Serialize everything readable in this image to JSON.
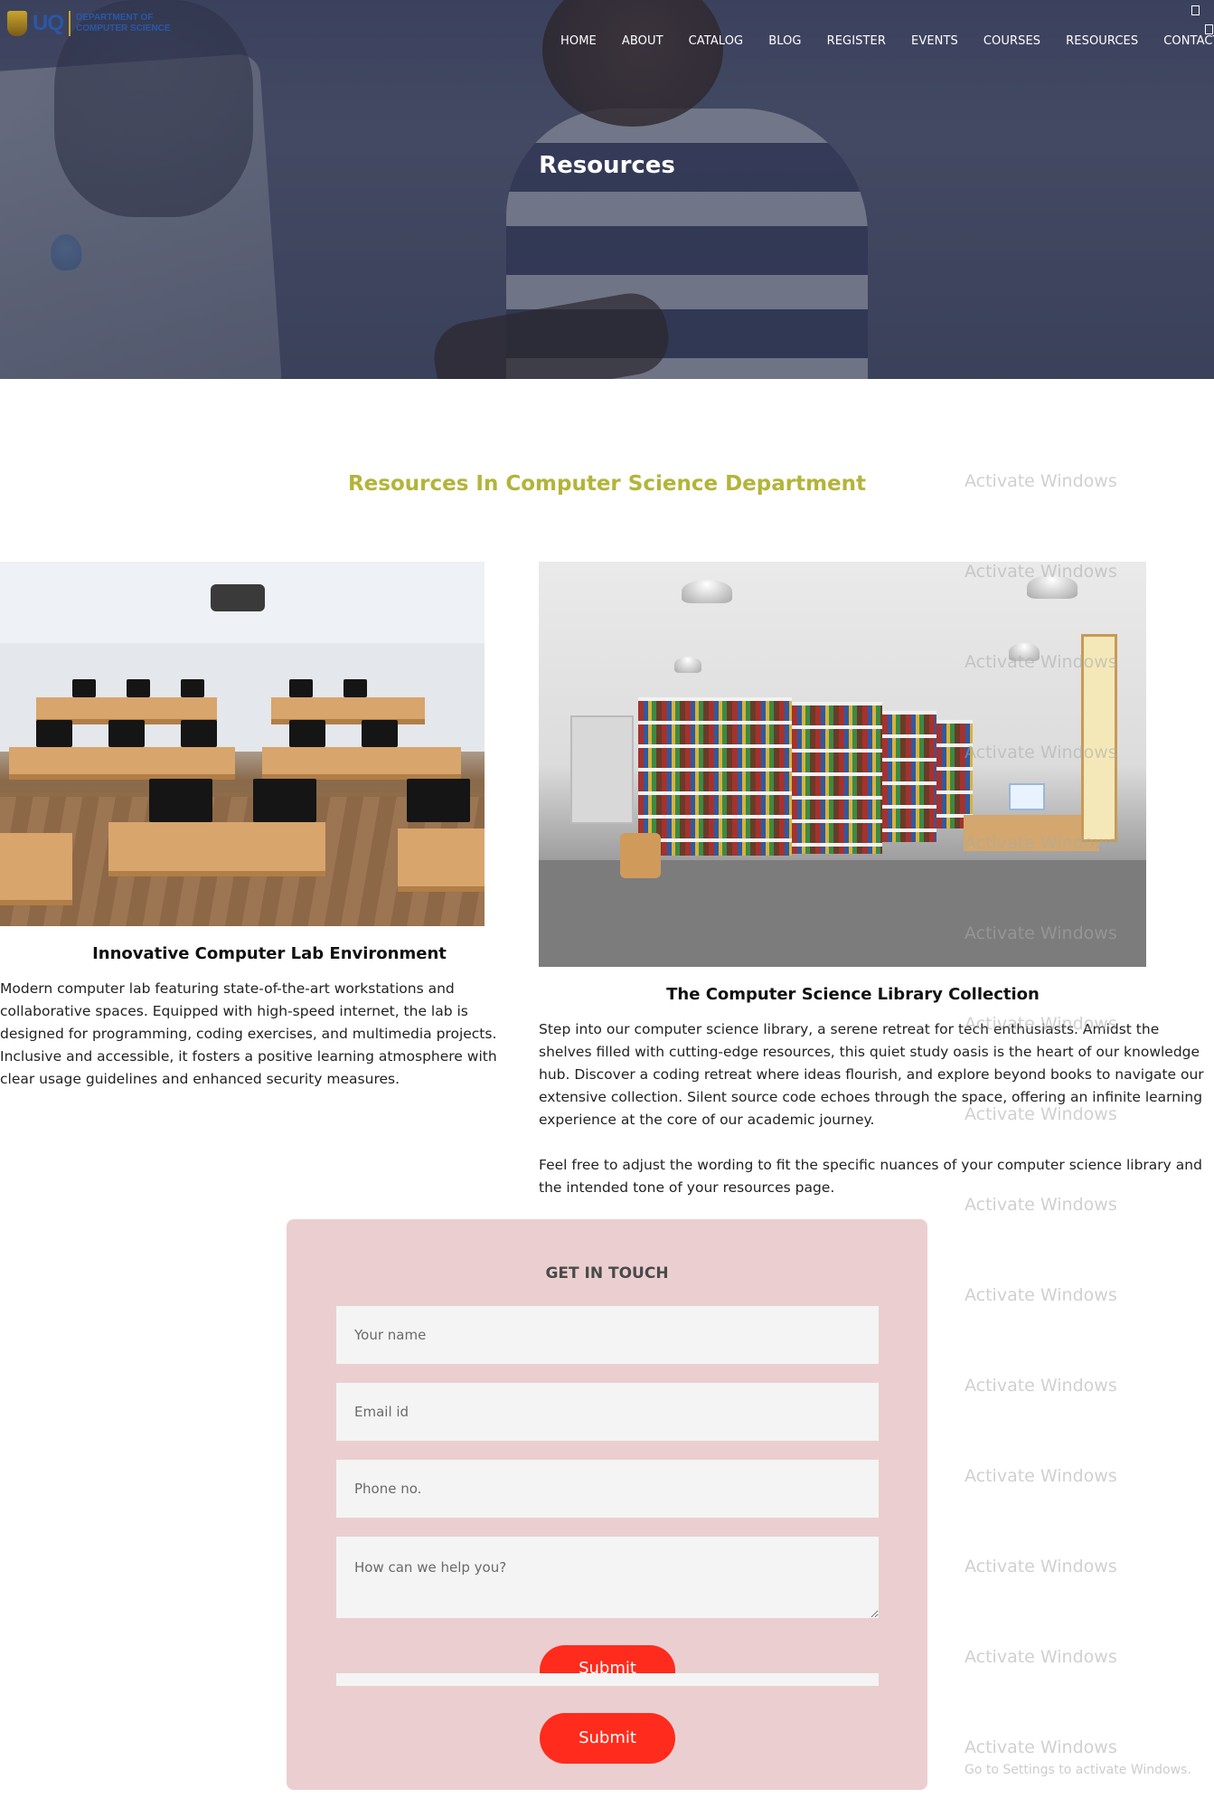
{
  "brand": {
    "short": "UQ",
    "line1": "Department of",
    "line2": "Computer Science"
  },
  "nav": {
    "items": [
      "HOME",
      "ABOUT",
      "CATALOG",
      "BLOG",
      "REGISTER",
      "EVENTS",
      "COURSES",
      "RESOURCES",
      "CONTACT"
    ]
  },
  "hero": {
    "title": "Resources"
  },
  "section": {
    "title": "Resources In Computer Science Department"
  },
  "cards": [
    {
      "title": "Innovative Computer Lab Environment",
      "text": "Modern computer lab featuring state-of-the-art workstations and collaborative spaces. Equipped with high-speed internet, the lab is designed for programming, coding exercises, and multimedia projects. Inclusive and accessible, it fosters a positive learning atmosphere with clear usage guidelines and enhanced security measures."
    },
    {
      "title": "The Computer Science Library Collection",
      "text": "Step into our computer science library, a serene retreat for tech enthusiasts. Amidst the shelves filled with cutting-edge resources, this quiet study oasis is the heart of our knowledge hub. Discover a coding retreat where ideas flourish, and explore beyond books to navigate our extensive collection. Silent source code echoes through the space, offering an infinite learning experience at the core of our academic journey.",
      "text2": "Feel free to adjust the wording to fit the specific nuances of your computer science library and the intended tone of your resources page."
    }
  ],
  "form": {
    "heading": "GET IN TOUCH",
    "name_placeholder": "Your name",
    "email_placeholder": "Email id",
    "phone_placeholder": "Phone no.",
    "message_placeholder": "How can we help you?",
    "submit_label": "Submit",
    "submit_label_duplicate": "Submit"
  },
  "watermark": {
    "text": "Activate Windows",
    "sub": "Go to Settings to activate Windows."
  },
  "colors": {
    "accent_title": "#b3b43a",
    "button": "#ff2b1c",
    "form_bg": "#ebcfd0"
  }
}
